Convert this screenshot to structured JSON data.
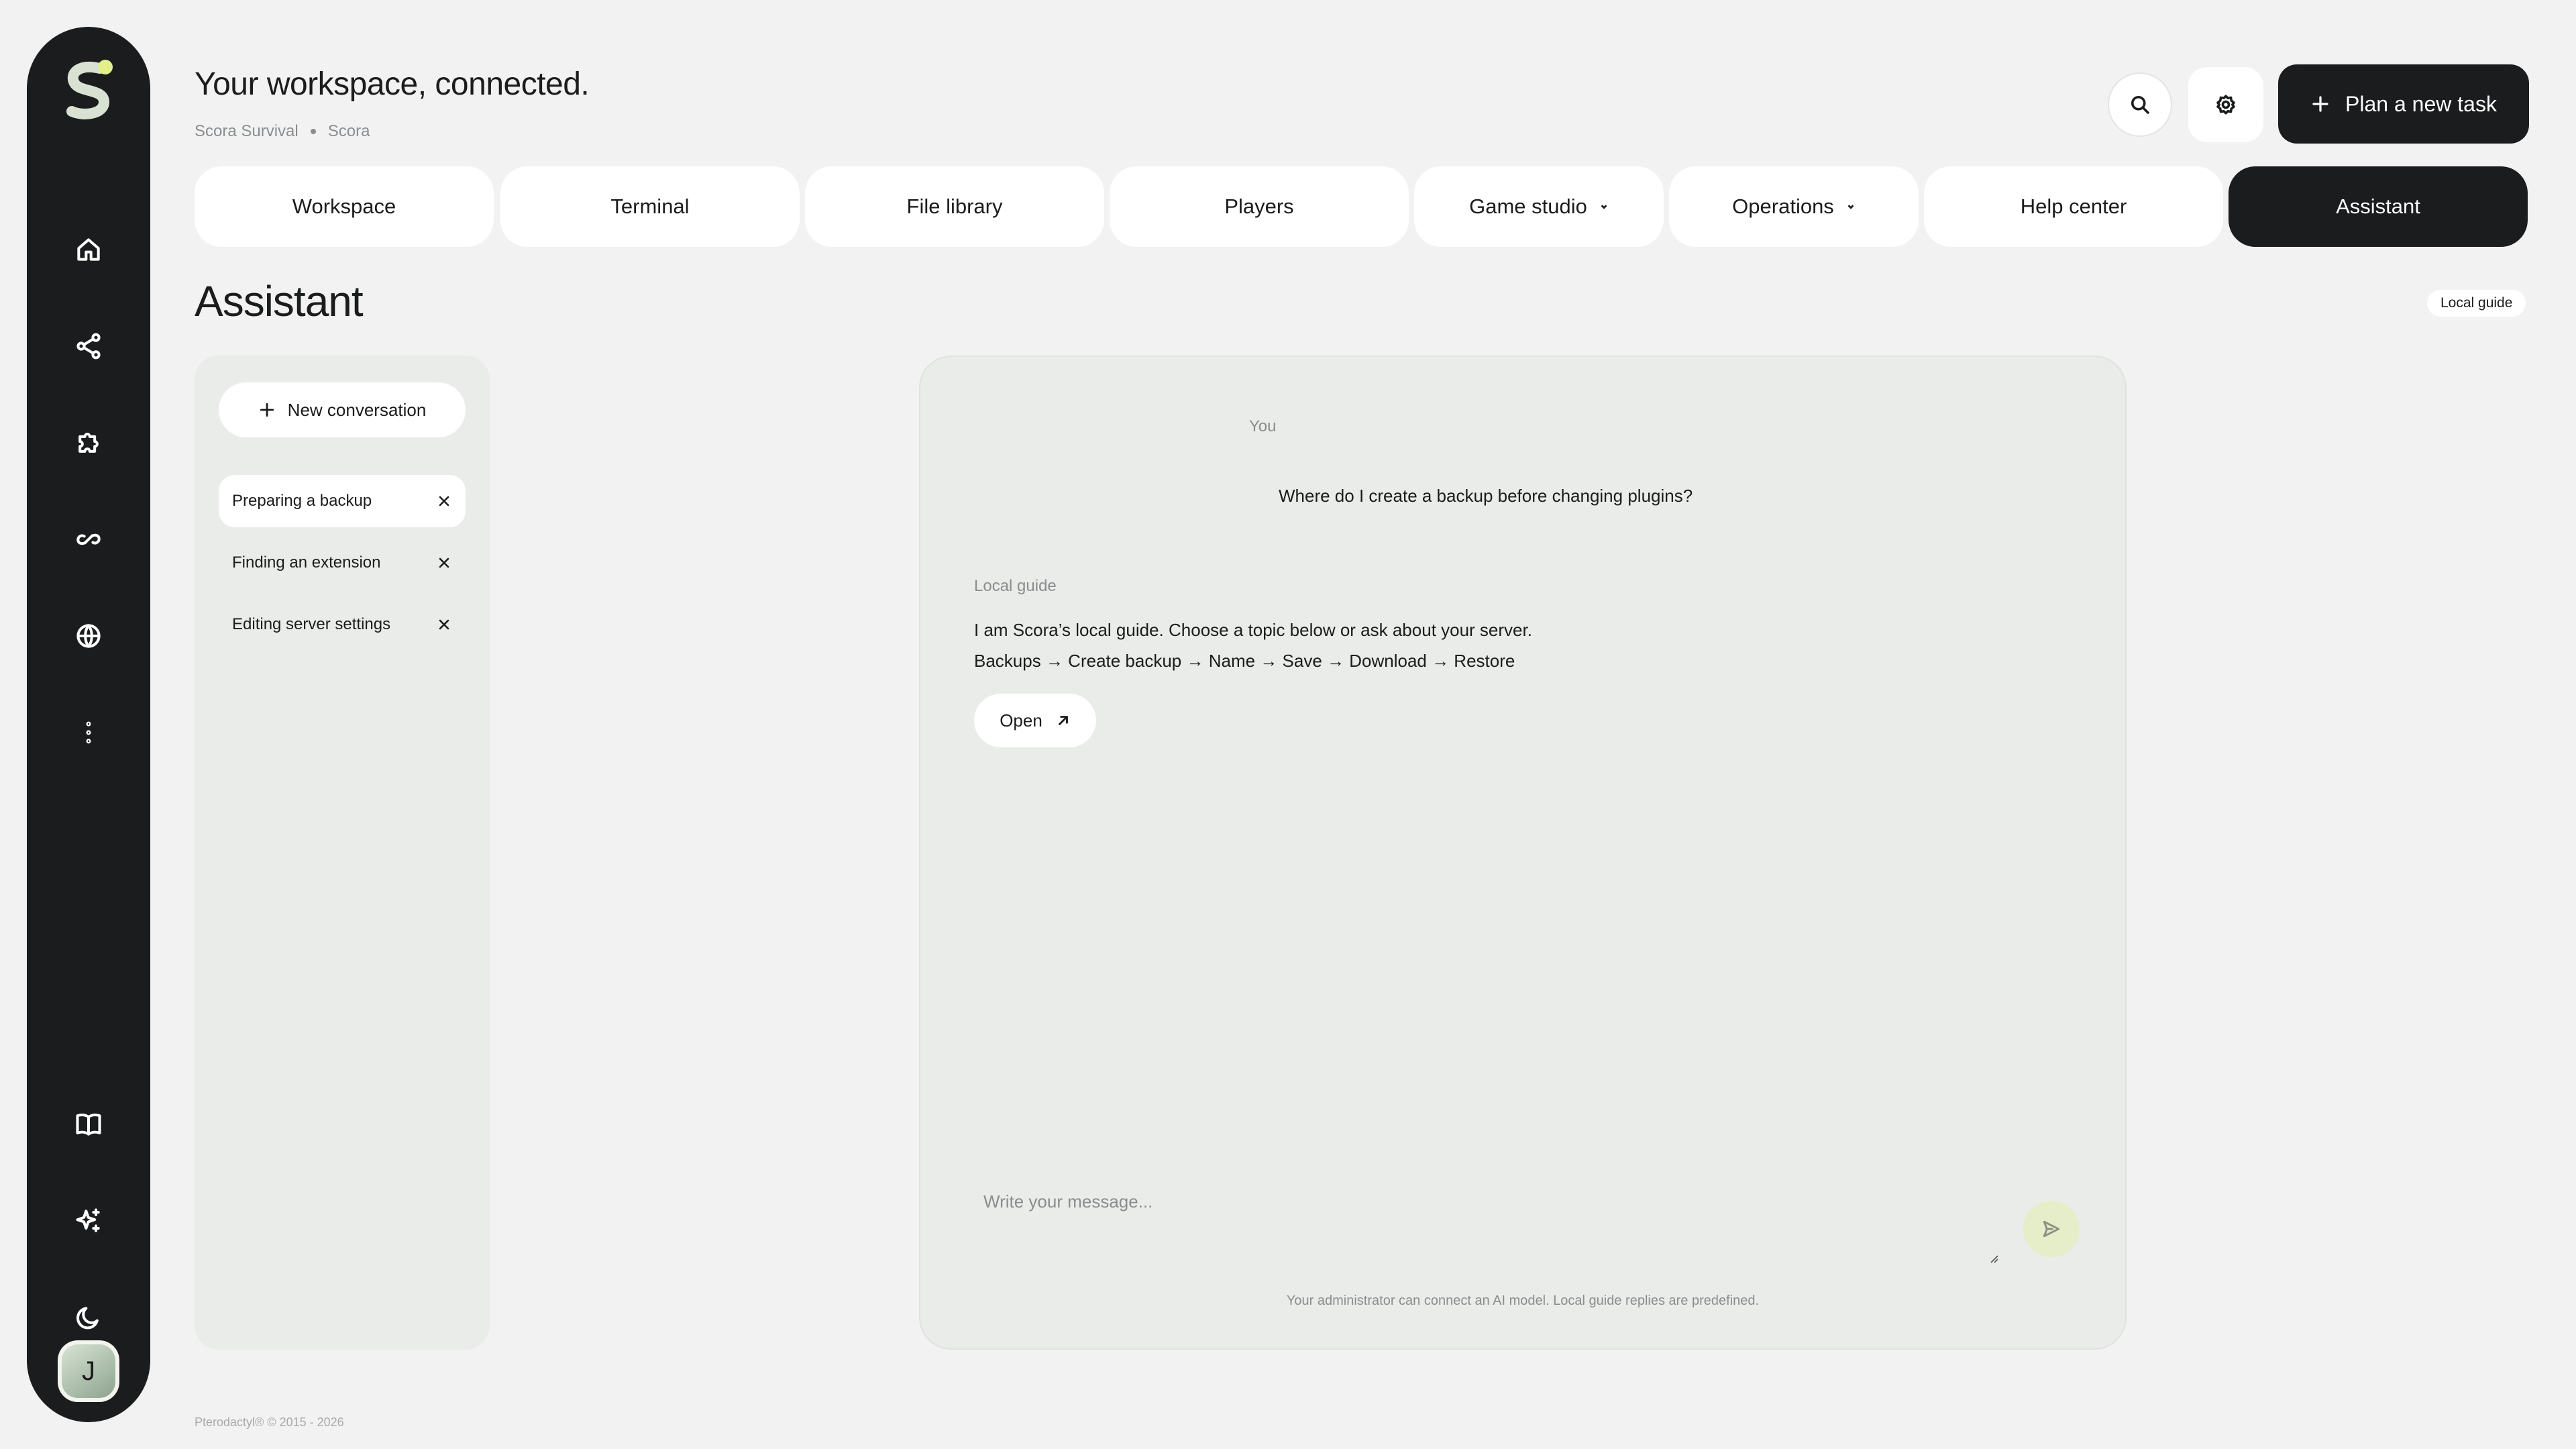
{
  "header": {
    "title": "Your workspace, connected.",
    "breadcrumb": [
      "Scora Survival",
      "Scora"
    ],
    "plan_button": "Plan a new task"
  },
  "sidebar": {
    "icons": [
      "home-icon",
      "share-icon",
      "puzzle-icon",
      "link-icon",
      "globe-icon",
      "more-vertical-icon",
      "book-icon",
      "sparkles-icon",
      "moon-icon"
    ],
    "avatar_initial": "J"
  },
  "tabs": [
    {
      "label": "Workspace"
    },
    {
      "label": "Terminal"
    },
    {
      "label": "File library"
    },
    {
      "label": "Players"
    },
    {
      "label": "Game studio",
      "dropdown": true
    },
    {
      "label": "Operations",
      "dropdown": true
    },
    {
      "label": "Help center"
    },
    {
      "label": "Assistant",
      "active": true
    }
  ],
  "page": {
    "heading": "Assistant",
    "badge": "Local guide"
  },
  "conversations": {
    "new_label": "New conversation",
    "items": [
      {
        "label": "Preparing a backup",
        "active": true
      },
      {
        "label": "Finding an extension"
      },
      {
        "label": "Editing server settings"
      }
    ]
  },
  "chat": {
    "user_label": "You",
    "user_message": "Where do I create a backup before changing plugins?",
    "bot_label": "Local guide",
    "bot_lines": [
      "I am Scora’s local guide. Choose a topic below or ask about your server.",
      "Backups → Create backup → Name → Save → Download → Restore"
    ],
    "open_label": "Open",
    "composer_placeholder": "Write your message...",
    "disclaimer": "Your administrator can connect an AI model. Local guide replies are predefined."
  },
  "colors": {
    "sidebar": "#1b1c1d",
    "accent_dot": "#e3f08a",
    "panel": "#e9ece8",
    "active_tab": "#1b1c1d",
    "send_button": "#e6edc9"
  },
  "footer": "Pterodactyl® © 2015 - 2026"
}
